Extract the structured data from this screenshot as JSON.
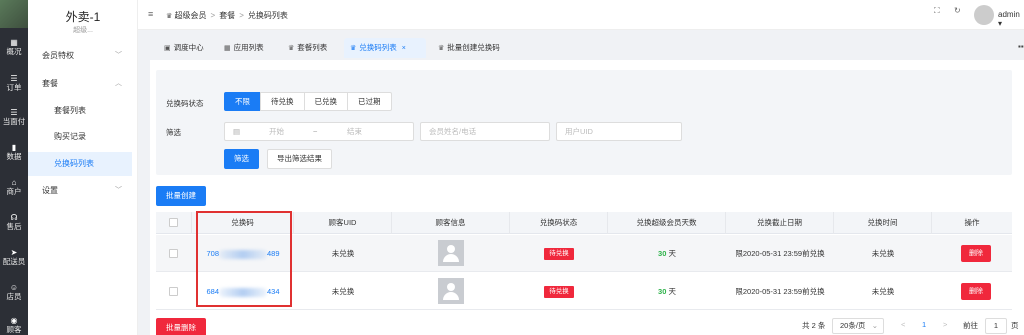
{
  "rail": {
    "items": [
      {
        "label": "概况",
        "icon": "▦"
      },
      {
        "label": "订单",
        "icon": "☰"
      },
      {
        "label": "当面付",
        "icon": "☰"
      },
      {
        "label": "数据",
        "icon": "▮"
      },
      {
        "label": "商户",
        "icon": "⌂"
      },
      {
        "label": "售后",
        "icon": "☊"
      },
      {
        "label": "配送员",
        "icon": "➤"
      },
      {
        "label": "店员",
        "icon": "☺"
      },
      {
        "label": "顾客",
        "icon": "◉"
      }
    ]
  },
  "sidebar": {
    "store_name": "外卖-1",
    "store_sub": "超级...",
    "menu": [
      {
        "label": "会员特权",
        "chevron": "﹀"
      },
      {
        "label": "套餐",
        "chevron": "︿"
      },
      {
        "label": "套餐列表"
      },
      {
        "label": "购买记录"
      },
      {
        "label": "兑换码列表"
      },
      {
        "label": "设置",
        "chevron": "﹀"
      }
    ]
  },
  "topbar": {
    "fold_icon": "≡",
    "crumb_root": "超级会员",
    "crumb_sep": ">",
    "crumb_mid": "套餐",
    "crumb_current": "兑换码列表",
    "fullscreen_icon": "⛶",
    "refresh_icon": "↻",
    "user": "admin ▾"
  },
  "tabs": {
    "items": [
      {
        "label": "调度中心",
        "icon": "▣"
      },
      {
        "label": "应用列表",
        "icon": "▦"
      },
      {
        "label": "套餐列表",
        "icon": "♛"
      },
      {
        "label": "兑换码列表",
        "icon": "♛",
        "close": "×"
      },
      {
        "label": "批量创建兑换码",
        "icon": "♛"
      }
    ],
    "more_icon": "▪▪"
  },
  "filter": {
    "status_label": "兑换码状态",
    "status_options": [
      "不限",
      "待兑换",
      "已兑换",
      "已过期"
    ],
    "selected_status": "不限",
    "screen_label": "筛选",
    "date_start_placeholder": "开始",
    "date_sep": "~",
    "date_end_placeholder": "结束",
    "member_placeholder": "会员姓名/电话",
    "uid_placeholder": "用户UID",
    "filter_button": "筛选",
    "export_button": "导出筛选结果"
  },
  "batch_create_button": "批量创建",
  "table": {
    "headers": [
      "兑换码",
      "顾客UID",
      "顾客信息",
      "兑换码状态",
      "兑换超级会员天数",
      "兑换截止日期",
      "兑换时间",
      "操作"
    ],
    "rows": [
      {
        "code_prefix": "708",
        "code_suffix": "489",
        "uid": "未兑换",
        "status": "待兑换",
        "days": "30",
        "days_unit": "天",
        "deadline": "限2020-05-31 23:59前兑换",
        "time": "未兑换",
        "action": "删除"
      },
      {
        "code_prefix": "684",
        "code_suffix": "434",
        "uid": "未兑换",
        "status": "待兑换",
        "days": "30",
        "days_unit": "天",
        "deadline": "限2020-05-31 23:59前兑换",
        "time": "未兑换",
        "action": "删除"
      }
    ]
  },
  "footer": {
    "batch_delete_button": "批量删除",
    "total": "共 2 条",
    "page_size": "20条/页",
    "prev": "<",
    "current_page": "1",
    "next": ">",
    "goto_label": "前往",
    "goto_value": "1",
    "page_unit": "页"
  },
  "colors": {
    "primary": "#1a7cf5",
    "danger": "#f0283c",
    "rail": "#2c2f36",
    "success": "#2db24a"
  }
}
